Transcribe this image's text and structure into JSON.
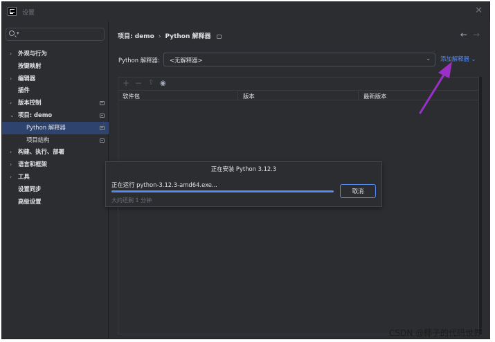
{
  "window": {
    "title": "设置"
  },
  "search": {
    "placeholder": "Q▾"
  },
  "sidebar": {
    "items": [
      {
        "label": "外观与行为",
        "expandable": true,
        "badge": false
      },
      {
        "label": "按键映射",
        "expandable": false,
        "badge": false
      },
      {
        "label": "编辑器",
        "expandable": true,
        "badge": false
      },
      {
        "label": "插件",
        "expandable": false,
        "badge": false
      },
      {
        "label": "版本控制",
        "expandable": true,
        "badge": true
      },
      {
        "label": "项目: demo",
        "expandable": true,
        "expanded": true,
        "badge": true
      },
      {
        "label": "Python 解释器",
        "child": true,
        "selected": true,
        "badge": true
      },
      {
        "label": "项目结构",
        "child": true,
        "badge": true
      },
      {
        "label": "构建、执行、部署",
        "expandable": true,
        "badge": false
      },
      {
        "label": "语言和框架",
        "expandable": true,
        "badge": false
      },
      {
        "label": "工具",
        "expandable": true,
        "badge": false
      },
      {
        "label": "设置同步",
        "expandable": false,
        "badge": false
      },
      {
        "label": "高级设置",
        "expandable": false,
        "badge": false
      }
    ]
  },
  "breadcrumb": {
    "parent": "项目: demo",
    "separator": "›",
    "current": "Python 解释器"
  },
  "interpreter": {
    "label": "Python 解释器:",
    "value": "<无解释器>",
    "add_label": "添加解释器 ⌄"
  },
  "packages": {
    "columns": [
      "软件包",
      "版本",
      "最新版本"
    ]
  },
  "dialog": {
    "title": "正在安装 Python 3.12.3",
    "status": "正在运行 python-3.12.3-amd64.exe...",
    "progress": 1.0,
    "remaining": "大约还剩 1 分钟",
    "cancel_label": "取消"
  },
  "watermark": "CSDN @椰子的代码世界",
  "colors": {
    "accent": "#548af7",
    "selection": "#2e436e",
    "annotation": "#9b30c8"
  }
}
